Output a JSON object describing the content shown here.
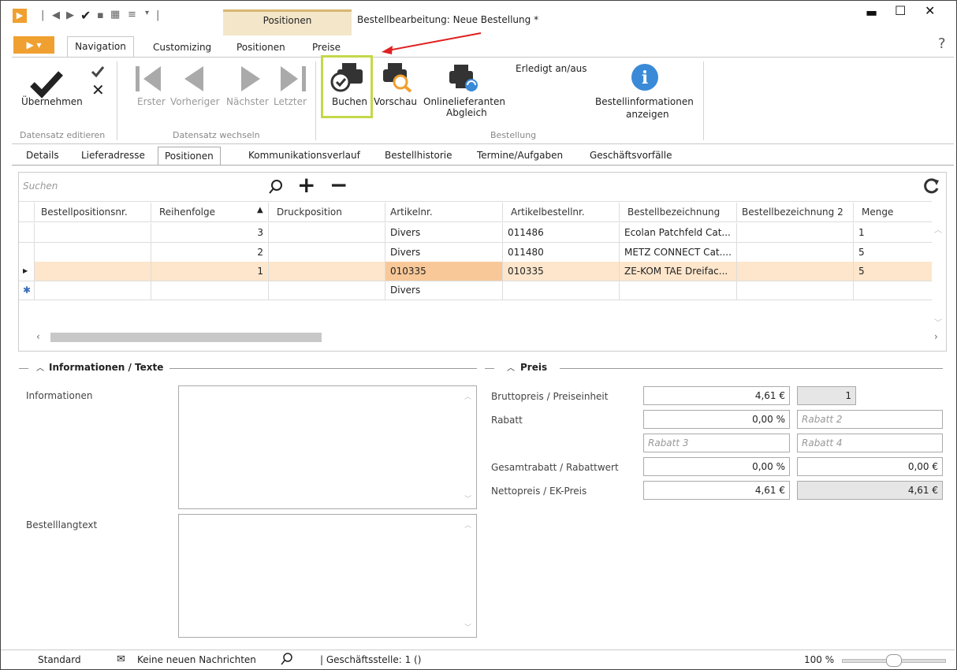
{
  "window": {
    "title": "Bestellbearbeitung: Neue Bestellung *",
    "context_group": "Positionen",
    "help": "?"
  },
  "ribbon": {
    "tabs": [
      "Navigation",
      "Customizing",
      "Positionen",
      "Preise"
    ],
    "buttons": {
      "uebernehmen": "Übernehmen",
      "erster": "Erster",
      "vorheriger": "Vorheriger",
      "naechster": "Nächster",
      "letzter": "Letzter",
      "buchen": "Buchen",
      "vorschau": "Vorschau",
      "onlinelieferanten_1": "Onlinelieferanten",
      "onlinelieferanten_2": "Abgleich",
      "erledigt": "Erledigt an/aus",
      "bestellinfo_1": "Bestellinformationen",
      "bestellinfo_2": "anzeigen"
    },
    "groups": {
      "datensatz_editieren": "Datensatz editieren",
      "datensatz_wechseln": "Datensatz wechseln",
      "bestellung": "Bestellung"
    }
  },
  "subtabs": [
    "Details",
    "Lieferadresse",
    "Positionen",
    "Kommunikationsverlauf",
    "Bestellhistorie",
    "Termine/Aufgaben",
    "Geschäftsvorfälle"
  ],
  "grid": {
    "search_placeholder": "Suchen",
    "columns": [
      "Bestellpositionsnr.",
      "Reihenfolge",
      "Druckposition",
      "Artikelnr.",
      "Artikelbestellnr.",
      "Bestellbezeichnung",
      "Bestellbezeichnung 2",
      "Menge"
    ],
    "rows": [
      {
        "reihenfolge": "3",
        "artikelnr": "Divers",
        "artikelbestellnr": "011486",
        "bezeichnung": "Ecolan Patchfeld Cat...",
        "menge": "1"
      },
      {
        "reihenfolge": "2",
        "artikelnr": "Divers",
        "artikelbestellnr": "011480",
        "bezeichnung": "METZ CONNECT Cat....",
        "menge": "5"
      },
      {
        "reihenfolge": "1",
        "artikelnr": "010335",
        "artikelbestellnr": "010335",
        "bezeichnung": "ZE-KOM TAE Dreifac...",
        "menge": "5"
      },
      {
        "reihenfolge": "",
        "artikelnr": "Divers",
        "artikelbestellnr": "",
        "bezeichnung": "",
        "menge": ""
      }
    ]
  },
  "info": {
    "section": "Informationen / Texte",
    "informationen": "Informationen",
    "bestelllangtext": "Bestelllangtext"
  },
  "preis": {
    "section": "Preis",
    "brutto_label": "Bruttopreis / Preiseinheit",
    "brutto_value": "4,61 €",
    "preiseinheit": "1",
    "rabatt_label": "Rabatt",
    "rabatt_value": "0,00 %",
    "rabatt2": "Rabatt 2",
    "rabatt3": "Rabatt 3",
    "rabatt4": "Rabatt 4",
    "gesamt_label": "Gesamtrabatt / Rabattwert",
    "gesamt_value": "0,00 %",
    "rabattwert": "0,00 €",
    "netto_label": "Nettopreis / EK-Preis",
    "netto_value": "4,61 €",
    "ek_value": "4,61 €"
  },
  "status": {
    "standard": "Standard",
    "messages": "Keine neuen Nachrichten",
    "branch": "| Geschäftsstelle: 1 ()",
    "zoom": "100 %"
  }
}
